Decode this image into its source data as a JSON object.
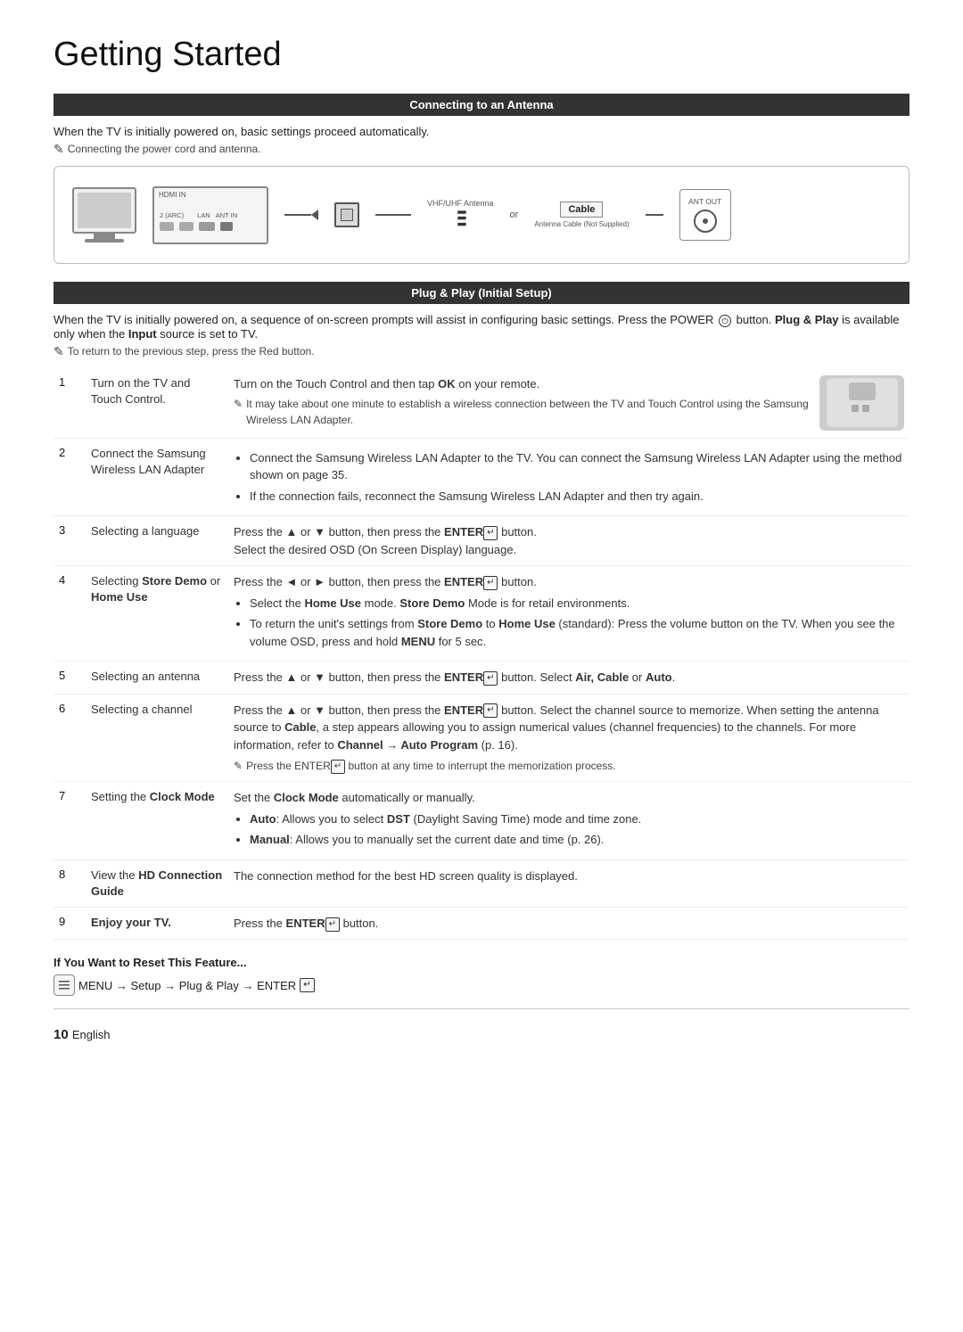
{
  "page": {
    "title": "Getting Started",
    "page_number": "10",
    "page_lang": "English"
  },
  "sections": {
    "antenna": {
      "header": "Connecting to an Antenna",
      "intro": "When the TV is initially powered on, basic settings proceed automatically.",
      "note": "Connecting the power cord and antenna.",
      "diagram": {
        "vhf_label": "VHF/UHF Antenna",
        "or_text": "or",
        "cable_label": "Cable",
        "ant_out_label": "ANT OUT",
        "cable_note": "Antenna Cable (Not Supplied)",
        "hdmi_label": "HDMI IN",
        "input_label": "2 (ARC)",
        "lan_label": "LAN",
        "ant_in_label": "ANT IN"
      }
    },
    "plug_play": {
      "header": "Plug & Play (Initial Setup)",
      "intro": "When the TV is initially powered on, a sequence of on-screen prompts will assist in configuring basic settings. Press the POWER",
      "intro2": "button. Plug & Play is available only when the Input source is set to TV.",
      "note": "To return to the previous step, press the Red button.",
      "steps": [
        {
          "num": "1",
          "label": "Turn on the TV and Touch Control.",
          "content_main": "Turn on the Touch Control and then tap OK on your remote.",
          "content_note": "It may take about one minute to establish a wireless connection between the TV and Touch Control using the Samsung Wireless LAN Adapter.",
          "has_image": true
        },
        {
          "num": "2",
          "label": "Connect the Samsung Wireless LAN Adapter",
          "bullets": [
            "Connect the Samsung Wireless LAN Adapter to the TV. You can connect the Samsung Wireless LAN Adapter using the method shown on page 35.",
            "If the connection fails, reconnect the Samsung Wireless LAN Adapter and then try again."
          ]
        },
        {
          "num": "3",
          "label": "Selecting a language",
          "content_main": "Press the ▲ or ▼ button, then press the ENTER",
          "content_main2": " button.",
          "content_sub": "Select the desired OSD (On Screen Display) language."
        },
        {
          "num": "4",
          "label_start": "Selecting ",
          "label_bold": "Store Demo",
          "label_mid": " or ",
          "label_bold2": "Home Use",
          "bullets": [
            "Press the ◄ or ► button, then press the ENTER button.",
            "Select the Home Use mode. Store Demo Mode is for retail environments.",
            "To return the unit's settings from Store Demo to Home Use (standard): Press the volume button on the TV. When you see the volume OSD, press and hold MENU for 5 sec."
          ],
          "step4_press": "Press the ◄ or ► button, then press the ENTER"
        },
        {
          "num": "5",
          "label": "Selecting an antenna",
          "content_main": "Press the ▲ or ▼ button, then press the ENTER",
          "content_main2": " button. Select Air, Cable or Auto."
        },
        {
          "num": "6",
          "label": "Selecting a channel",
          "content_main": "Press the ▲ or ▼ button, then press the ENTER",
          "content_main2": " button. Select the channel source to memorize. When setting the antenna source to Cable, a step appears allowing you to assign numerical values (channel frequencies) to the channels. For more information, refer to",
          "content_bold": "Channel → Auto Program",
          "content_end": " (p. 16).",
          "content_note": "Press the ENTER button at any time to interrupt the memorization process."
        },
        {
          "num": "7",
          "label_start": "Setting the ",
          "label_bold": "Clock",
          "label_end": " Mode",
          "content_main": "Set the Clock Mode automatically or manually.",
          "bullets": [
            "Auto: Allows you to select DST (Daylight Saving Time) mode and time zone.",
            "Manual: Allows you to manually set the current date and time (p. 26)."
          ]
        },
        {
          "num": "8",
          "label_start": "View the ",
          "label_bold": "HD",
          "label_end": " Connection Guide",
          "content_main": "The connection method for the best HD screen quality is displayed."
        },
        {
          "num": "9",
          "label_bold": "Enjoy your TV.",
          "content_main": "Press the ENTER",
          "content_main2": " button."
        }
      ]
    },
    "reset": {
      "title": "If You Want to Reset This Feature...",
      "menu_path": "MENU → Setup → Plug & Play → ENTER"
    }
  }
}
